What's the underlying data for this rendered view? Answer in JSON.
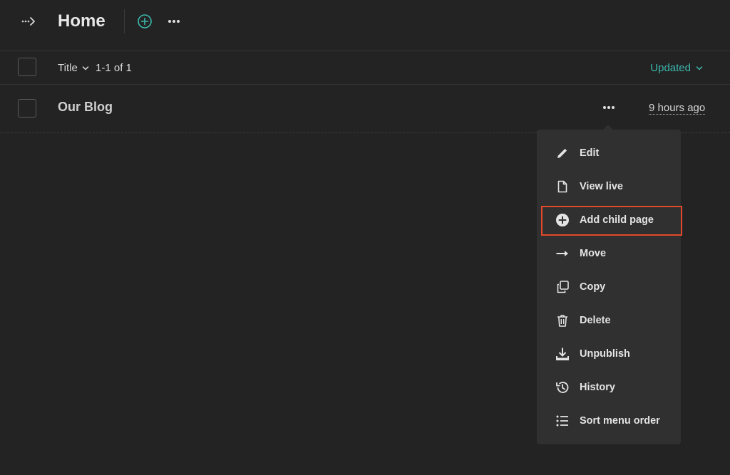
{
  "header": {
    "title": "Home"
  },
  "list": {
    "title_column": "Title",
    "count": "1-1 of 1",
    "updated_column": "Updated"
  },
  "rows": [
    {
      "title": "Our Blog",
      "updated": "9 hours ago"
    }
  ],
  "menu": {
    "items": [
      {
        "label": "Edit",
        "icon": "pencil-icon"
      },
      {
        "label": "View live",
        "icon": "document-icon"
      },
      {
        "label": "Add child page",
        "icon": "plus-circle-icon"
      },
      {
        "label": "Move",
        "icon": "arrow-right-icon"
      },
      {
        "label": "Copy",
        "icon": "copy-icon"
      },
      {
        "label": "Delete",
        "icon": "trash-icon"
      },
      {
        "label": "Unpublish",
        "icon": "download-icon"
      },
      {
        "label": "History",
        "icon": "history-icon"
      },
      {
        "label": "Sort menu order",
        "icon": "list-icon"
      }
    ],
    "highlighted": "Add child page"
  },
  "colors": {
    "accent": "#3bb8ad",
    "highlight": "#e2492a",
    "background": "#232323",
    "menu": "#303030"
  }
}
